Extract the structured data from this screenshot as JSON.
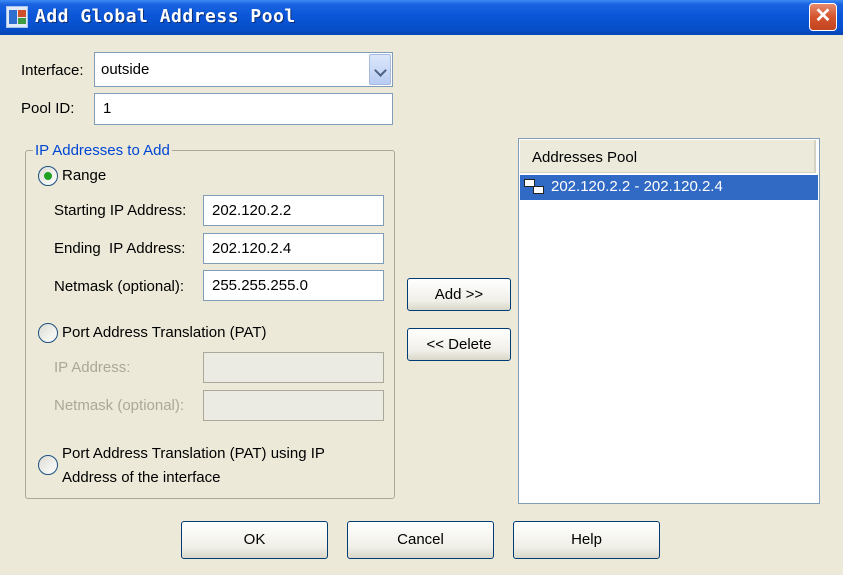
{
  "window": {
    "title": "Add Global Address Pool"
  },
  "interface": {
    "label": "Interface:",
    "value": "outside"
  },
  "pool_id": {
    "label": "Pool ID:",
    "value": "1"
  },
  "ip_group": {
    "legend": "IP Addresses to Add",
    "range": {
      "label": "Range",
      "selected": true,
      "start_label": "Starting IP Address:",
      "start_value": "202.120.2.2",
      "end_label": "Ending  IP Address:",
      "end_value": "202.120.2.4",
      "netmask_label": "Netmask (optional):",
      "netmask_value": "255.255.255.0"
    },
    "pat": {
      "label": "Port Address Translation (PAT)",
      "selected": false,
      "ip_label": "IP Address:",
      "ip_value": "",
      "netmask_label": "Netmask (optional):",
      "netmask_value": ""
    },
    "pat_interface": {
      "label_line1": "Port Address Translation (PAT) using IP",
      "label_line2": "Address of the interface",
      "selected": false
    }
  },
  "actions": {
    "add_label": "Add >>",
    "delete_label": "<< Delete"
  },
  "addresses_pool": {
    "header": "Addresses Pool",
    "items": [
      {
        "label": "202.120.2.2 - 202.120.2.4",
        "icon": "network-pool-icon",
        "selected": true
      }
    ]
  },
  "footer": {
    "ok_label": "OK",
    "cancel_label": "Cancel",
    "help_label": "Help"
  },
  "colors": {
    "title_bar": "#0a56d8",
    "selection": "#316ac5",
    "group_legend": "#0046d5",
    "radio_dot": "#21a121"
  }
}
